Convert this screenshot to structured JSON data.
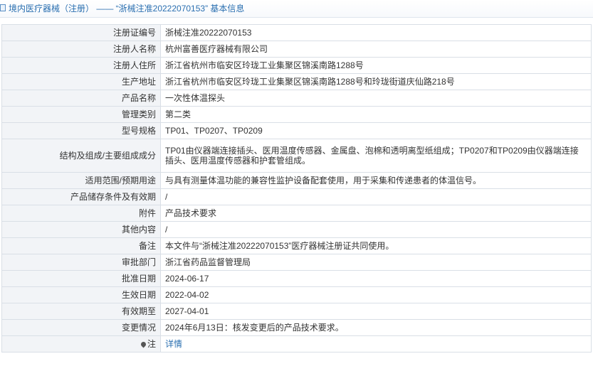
{
  "header": {
    "title": "境内医疗器械（注册） —— “浙械注准20222070153” 基本信息"
  },
  "rows": [
    {
      "label": "注册证编号",
      "value": "浙械注准20222070153"
    },
    {
      "label": "注册人名称",
      "value": "杭州富善医疗器械有限公司"
    },
    {
      "label": "注册人住所",
      "value": "浙江省杭州市临安区玲珑工业集聚区锦溪南路1288号"
    },
    {
      "label": "生产地址",
      "value": "浙江省杭州市临安区玲珑工业集聚区锦溪南路1288号和玲珑街道庆仙路218号"
    },
    {
      "label": "产品名称",
      "value": "一次性体温探头"
    },
    {
      "label": "管理类别",
      "value": "第二类"
    },
    {
      "label": "型号规格",
      "value": "TP01、TP0207、TP0209"
    },
    {
      "label": "结构及组成/主要组成成分",
      "value": "TP01由仪器端连接插头、医用温度传感器、金属盘、泡棉和透明离型纸组成；TP0207和TP0209由仪器端连接插头、医用温度传感器和护套管组成。"
    },
    {
      "label": "适用范围/预期用途",
      "value": "与具有测量体温功能的兼容性监护设备配套使用，用于采集和传递患者的体温信号。"
    },
    {
      "label": "产品储存条件及有效期",
      "value": "/"
    },
    {
      "label": "附件",
      "value": "产品技术要求"
    },
    {
      "label": "其他内容",
      "value": "/"
    },
    {
      "label": "备注",
      "value": "本文件与“浙械注准20222070153”医疗器械注册证共同使用。"
    },
    {
      "label": "审批部门",
      "value": "浙江省药品监督管理局"
    },
    {
      "label": "批准日期",
      "value": "2024-06-17"
    },
    {
      "label": "生效日期",
      "value": "2022-04-02"
    },
    {
      "label": "有效期至",
      "value": "2027-04-01"
    },
    {
      "label": "变更情况",
      "value": "2024年6月13日：核发变更后的产品技术要求。"
    }
  ],
  "footer": {
    "label": "注",
    "link": "详情",
    "icon": "pin-icon"
  }
}
